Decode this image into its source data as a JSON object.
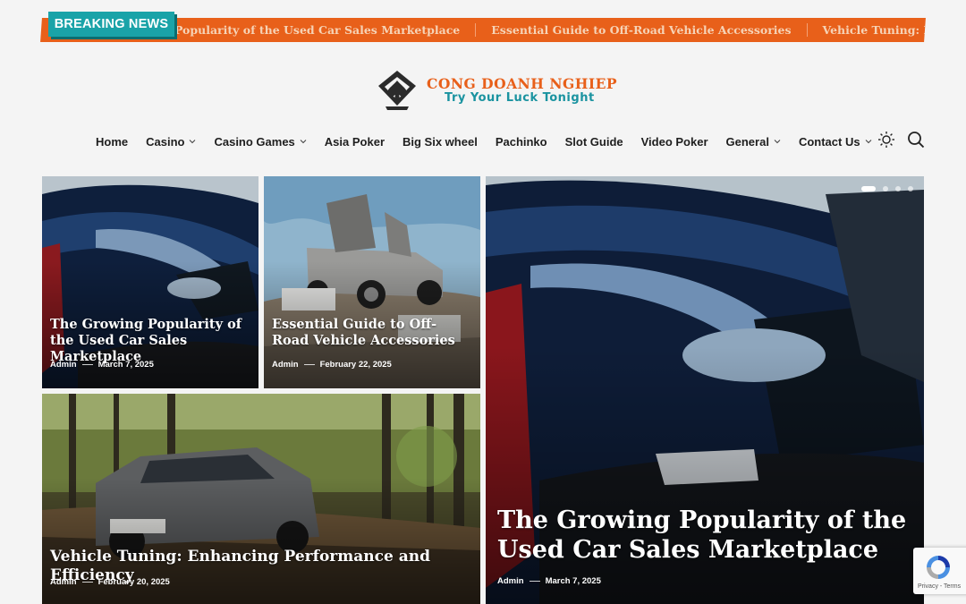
{
  "ticker": {
    "badge": "BREAKING NEWS",
    "items": [
      "The Growing Popularity of the Used Car Sales Marketplace",
      "Essential Guide to Off-Road Vehicle Accessories",
      "Vehicle Tuning: Enhancing Performance and Efficiency"
    ]
  },
  "logo": {
    "name": "CONG DOANH NGHIEP",
    "tagline": "Try Your Luck Tonight"
  },
  "nav": {
    "items": [
      {
        "label": "Home"
      },
      {
        "label": "Casino"
      },
      {
        "label": "Casino Games"
      },
      {
        "label": "Asia Poker"
      },
      {
        "label": "Big Six wheel"
      },
      {
        "label": "Pachinko"
      },
      {
        "label": "Slot Guide"
      },
      {
        "label": "Video Poker"
      },
      {
        "label": "General"
      },
      {
        "label": "Contact Us"
      }
    ]
  },
  "posts": [
    {
      "title": "The Growing Popularity of the Used Car Sales Marketplace",
      "author": "Admin",
      "date": "March 7, 2025"
    },
    {
      "title": "Essential Guide to Off-Road Vehicle Accessories",
      "author": "Admin",
      "date": "February 22, 2025"
    },
    {
      "title": "Vehicle Tuning: Enhancing Performance and Efficiency",
      "author": "Admin",
      "date": "February 20, 2025"
    },
    {
      "title": "The Growing Popularity of the Used Car Sales Marketplace",
      "author": "Admin",
      "date": "March 7, 2025"
    }
  ],
  "recaptcha": {
    "text": "Privacy - Terms"
  },
  "colors": {
    "accent": "#e8601a",
    "teal": "#1aa3a8"
  }
}
